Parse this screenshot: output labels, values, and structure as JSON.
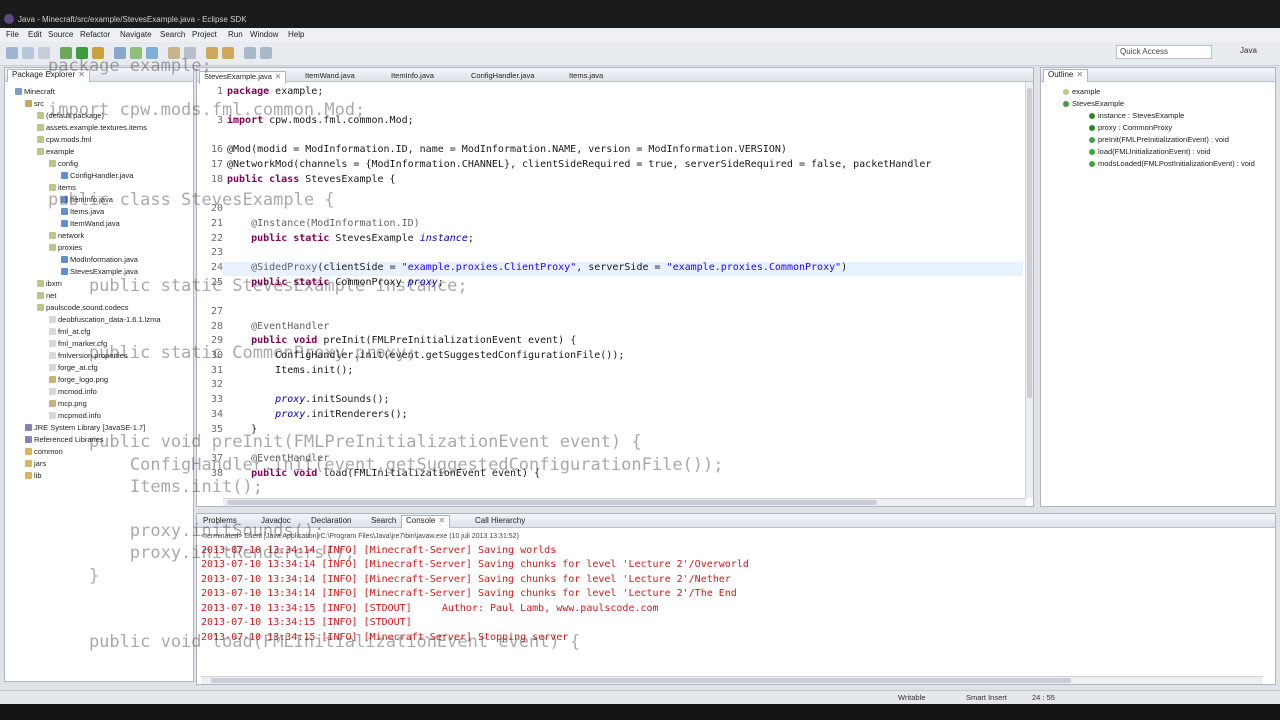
{
  "window": {
    "title": "Java - Minecraft/src/example/StevesExample.java - Eclipse SDK"
  },
  "menu": [
    "File",
    "Edit",
    "Source",
    "Refactor",
    "Navigate",
    "Search",
    "Project",
    "Run",
    "Window",
    "Help"
  ],
  "toolbar": {
    "quick_access": "Quick Access",
    "perspective": "Java"
  },
  "package_explorer": {
    "tab": "Package Explorer",
    "items": [
      "Minecraft",
      "src",
      "(default package)",
      "assets.example.textures.items",
      "cpw.mods.fml",
      "example",
      "config",
      "ConfigHandler.java",
      "items",
      "ItemInfo.java",
      "Items.java",
      "ItemWand.java",
      "network",
      "proxies",
      "ModInformation.java",
      "StevesExample.java",
      "ibxm",
      "net",
      "paulscode.sound.codecs",
      "deobfuscation_data-1.6.1.lzma",
      "fml_at.cfg",
      "fml_marker.cfg",
      "fmlversion.properties",
      "forge_at.cfg",
      "forge_logo.png",
      "mcmod.info",
      "mcp.png",
      "mcpmod.info",
      "JRE System Library [JavaSE-1.7]",
      "Referenced Libraries",
      "common",
      "jars",
      "lib"
    ]
  },
  "editor": {
    "tabs": [
      "StevesExample.java",
      "ItemWand.java",
      "ItemInfo.java",
      "ConfigHandler.java",
      "Items.java"
    ],
    "lines": [
      {
        "n": "1",
        "t": "package example;"
      },
      {
        "n": "3",
        "t": "import cpw.mods.fml.common.Mod;"
      },
      {
        "n": "16",
        "t": "@Mod(modid = ModInformation.ID, name = ModInformation.NAME, version = ModInformation.VERSION)"
      },
      {
        "n": "17",
        "t": "@NetworkMod(channels = {ModInformation.CHANNEL}, clientSideRequired = true, serverSideRequired = false, packetHandler"
      },
      {
        "n": "18",
        "t": "public class StevesExample {"
      },
      {
        "n": "20",
        "t": ""
      },
      {
        "n": "21",
        "t": "    @Instance(ModInformation.ID)"
      },
      {
        "n": "22",
        "t": "    public static StevesExample instance;"
      },
      {
        "n": "23",
        "t": ""
      },
      {
        "n": "24",
        "t": "    @SidedProxy(clientSide = \"example.proxies.ClientProxy\", serverSide = \"example.proxies.CommonProxy\")"
      },
      {
        "n": "25",
        "t": "    public static CommonProxy proxy;"
      },
      {
        "n": "27",
        "t": ""
      },
      {
        "n": "28",
        "t": "    @EventHandler"
      },
      {
        "n": "29",
        "t": "    public void preInit(FMLPreInitializationEvent event) {"
      },
      {
        "n": "30",
        "t": "        ConfigHandler.init(event.getSuggestedConfigurationFile());"
      },
      {
        "n": "31",
        "t": "        Items.init();"
      },
      {
        "n": "32",
        "t": ""
      },
      {
        "n": "33",
        "t": "        proxy.initSounds();"
      },
      {
        "n": "34",
        "t": "        proxy.initRenderers();"
      },
      {
        "n": "35",
        "t": "    }"
      },
      {
        "n": "37",
        "t": "    @EventHandler"
      },
      {
        "n": "38",
        "t": "    public void load(FMLInitializationEvent event) {"
      }
    ]
  },
  "outline": {
    "tab": "Outline",
    "items": [
      "example",
      "StevesExample",
      "instance : StevesExample",
      "proxy : CommonProxy",
      "preInit(FMLPreInitializationEvent) : void",
      "load(FMLInitializationEvent) : void",
      "modsLoaded(FMLPostInitializationEvent) : void"
    ]
  },
  "console": {
    "tabs": [
      "Problems",
      "Javadoc",
      "Declaration",
      "Search",
      "Console",
      "Call Hierarchy"
    ],
    "terminated": "<terminated> Client [Java Application] C:\\Program Files\\Java\\jre7\\bin\\javaw.exe (10 juli 2013 13:31:52)",
    "lines": [
      "2013-07-10 13:34:14 [INFO] [Minecraft-Server] Saving worlds",
      "2013-07-10 13:34:14 [INFO] [Minecraft-Server] Saving chunks for level 'Lecture 2'/Overworld",
      "2013-07-10 13:34:14 [INFO] [Minecraft-Server] Saving chunks for level 'Lecture 2'/Nether",
      "2013-07-10 13:34:14 [INFO] [Minecraft-Server] Saving chunks for level 'Lecture 2'/The End",
      "2013-07-10 13:34:15 [INFO] [STDOUT]     Author: Paul Lamb, www.paulscode.com",
      "2013-07-10 13:34:15 [INFO] [STDOUT]",
      "2013-07-10 13:34:15 [INFO] [Minecraft-Server] Stopping server"
    ]
  },
  "status": {
    "writable": "Writable",
    "insert": "Smart Insert",
    "position": "24 : 55"
  },
  "colors": {
    "keyword": "#7f0055",
    "string": "#2a00ff",
    "console_err": "#d61a1a",
    "annotation": "#646464"
  }
}
